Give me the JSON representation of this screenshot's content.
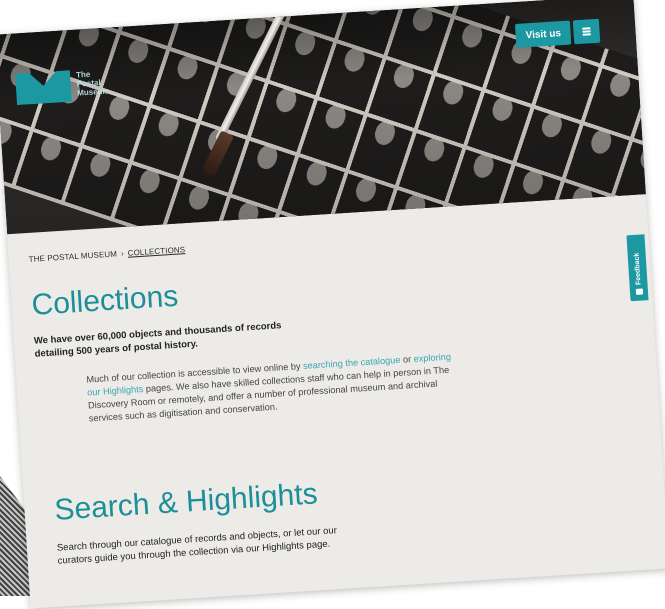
{
  "header": {
    "logo_text": "The Postal Museum",
    "visit_label": "Visit us",
    "menu_icon": "menu-icon",
    "accent_color": "#1c98a2"
  },
  "breadcrumb": {
    "home": "THE POSTAL MUSEUM",
    "separator": "›",
    "current": "COLLECTIONS"
  },
  "main": {
    "title": "Collections",
    "intro": "We have over 60,000 objects and thousands of records detailing 500 years of postal history.",
    "body_part1": "Much of our collection is accessible to view online by ",
    "link_catalogue": "searching the catalogue",
    "body_part2": " or ",
    "link_highlights": "exploring our Highlights",
    "body_part3": " pages. We also have skilled collections staff who can help in person in The Discovery Room or remotely, and offer a number of professional museum and archival services such as digitisation and conservation.",
    "section_title": "Search & Highlights",
    "section_text": "Search through our catalogue of records and objects, or let our our curators guide you through the collection via our Highlights page."
  },
  "feedback": {
    "label": "Feedback",
    "icon": "feedback-icon"
  }
}
